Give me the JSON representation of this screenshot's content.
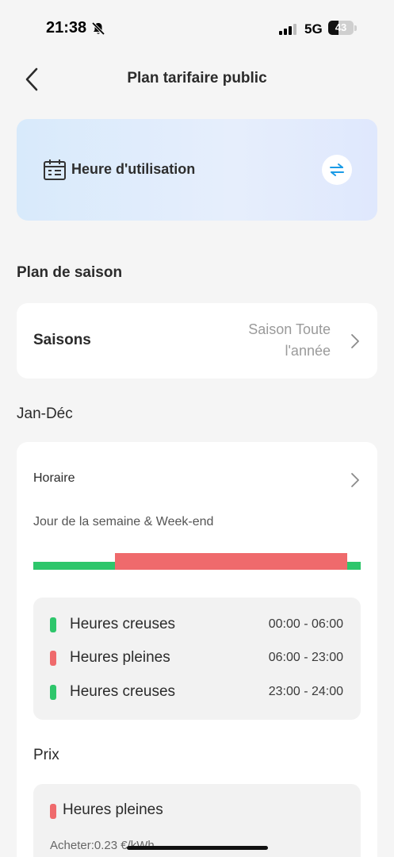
{
  "status_bar": {
    "time": "21:38",
    "network": "5G",
    "battery": "43",
    "icons": [
      "bell-off-icon",
      "signal-icon",
      "battery-icon"
    ]
  },
  "header": {
    "title": "Plan tarifaire public",
    "back_icon": "chevron-left-icon"
  },
  "banner": {
    "title": "Heure d'utilisation",
    "icon": "calendar-icon",
    "action_icon": "swap-arrows-icon",
    "action_color": "#1a9be6"
  },
  "season_plan": {
    "section_title": "Plan de saison",
    "seasons_label": "Saisons",
    "seasons_value": "Saison Toute l'année"
  },
  "period_block": {
    "range_title": "Jan-Déc",
    "schedule_label": "Horaire",
    "days_label": "Jour de la semaine & Week-end",
    "timeline": [
      {
        "type": "off_peak",
        "start": 0,
        "end": 6
      },
      {
        "type": "peak",
        "start": 6,
        "end": 23
      },
      {
        "type": "off_peak",
        "start": 23,
        "end": 24
      }
    ],
    "periods": [
      {
        "name": "Heures creuses",
        "time": "00:00 - 06:00",
        "type": "off_peak"
      },
      {
        "name": "Heures pleines",
        "time": "06:00 - 23:00",
        "type": "peak"
      },
      {
        "name": "Heures creuses",
        "time": "23:00 - 24:00",
        "type": "off_peak"
      }
    ]
  },
  "price": {
    "title": "Prix",
    "item_name": "Heures pleines",
    "buy_text": "Acheter:0.23 €/kWh"
  },
  "colors": {
    "off_peak": "#2ec66b",
    "peak": "#ef6a6c",
    "background": "#f5f5f5"
  }
}
